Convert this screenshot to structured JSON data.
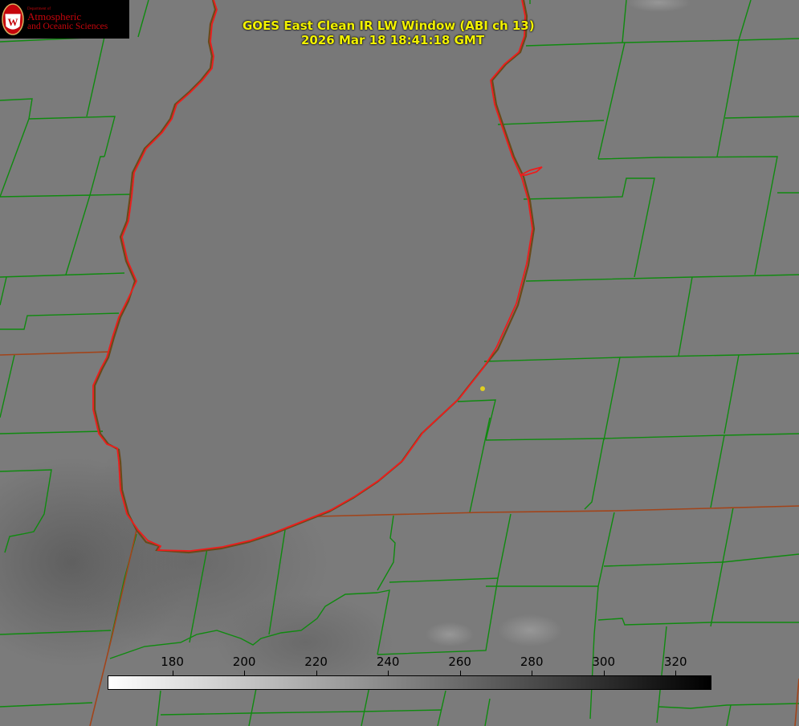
{
  "logo": {
    "department": "Department of",
    "line1": "Atmospheric",
    "line2": "and Oceanic Sciences",
    "seal_letter": "W"
  },
  "title": {
    "line1": "GOES East Clean IR LW Window (ABI ch 13)",
    "line2": "2026 Mar 18 18:41:18 GMT"
  },
  "colorbar": {
    "ticks": [
      "180",
      "200",
      "220",
      "240",
      "260",
      "280",
      "300",
      "320"
    ],
    "min": 162,
    "max": 330
  },
  "colors": {
    "background": "#7a7a7a",
    "lake_fill": "#787878",
    "lake_outline": "#ee1c1c",
    "county_lines": "#0f8a0f",
    "state_lines": "#a2441a",
    "title_text": "#f2f200",
    "marker": "#e0d020"
  },
  "icons": {
    "marker": "dot-marker-icon",
    "seal": "uw-seal-icon"
  }
}
